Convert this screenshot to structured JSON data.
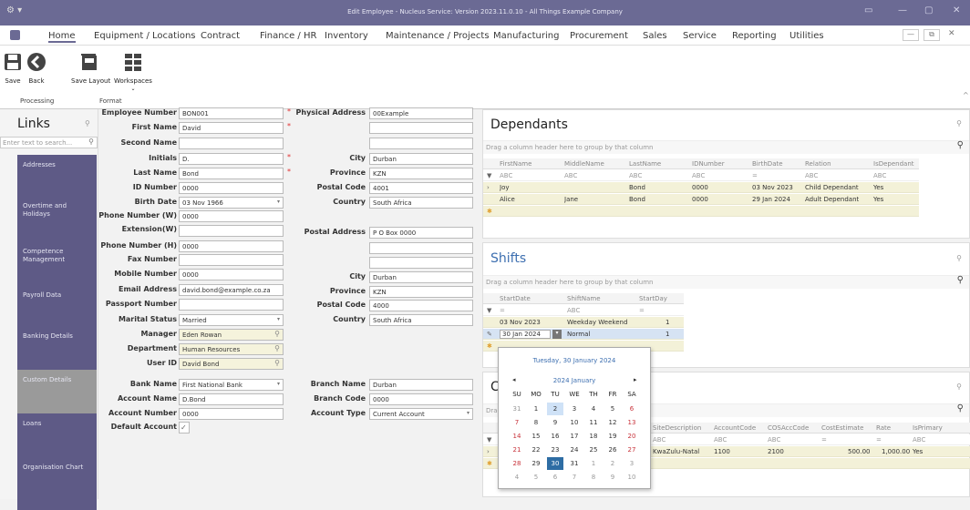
{
  "window": {
    "title": "Edit Employee - Nucleus Service: Version 2023.11.0.10 - All Things Example Company",
    "app_icon": "gear-icon"
  },
  "menu": [
    "Home",
    "Equipment / Locations",
    "Contract",
    "Finance / HR",
    "Inventory",
    "Maintenance / Projects",
    "Manufacturing",
    "Procurement",
    "Sales",
    "Service",
    "Reporting",
    "Utilities"
  ],
  "ribbon": {
    "save": "Save",
    "back": "Back",
    "save_layout": "Save Layout",
    "workspaces": "Workspaces",
    "group_processing": "Processing",
    "group_format": "Format"
  },
  "links": {
    "title": "Links",
    "search_placeholder": "Enter text to search...",
    "items": [
      "Addresses",
      "Overtime and Holidays",
      "Competence Management",
      "Payroll Data",
      "Banking Details",
      "Custom Details",
      "Loans",
      "Organisation Chart"
    ]
  },
  "employee": {
    "labels": {
      "employee_number": "Employee Number",
      "first_name": "First Name",
      "second_name": "Second Name",
      "initials": "Initials",
      "last_name": "Last Name",
      "id_number": "ID Number",
      "birth_date": "Birth Date",
      "phone_w": "Phone Number (W)",
      "extension": "Extension(W)",
      "phone_h": "Phone Number (H)",
      "fax": "Fax Number",
      "mobile": "Mobile Number",
      "email": "Email Address",
      "passport": "Passport Number",
      "marital": "Marital Status",
      "manager": "Manager",
      "department": "Department",
      "user_id": "User ID",
      "bank_name": "Bank Name",
      "account_name": "Account Name",
      "account_number": "Account Number",
      "default_account": "Default Account"
    },
    "values": {
      "employee_number": "BON001",
      "first_name": "David",
      "second_name": "",
      "initials": "D.",
      "last_name": "Bond",
      "id_number": "0000",
      "birth_date": "03 Nov 1966",
      "phone_w": "0000",
      "extension": "",
      "phone_h": "0000",
      "fax": "",
      "mobile": "0000",
      "email": "david.bond@example.co.za",
      "passport": "",
      "marital": "Married",
      "manager": "Eden Rowan",
      "department": "Human Resources",
      "user_id": "David Bond",
      "bank_name": "First National Bank",
      "account_name": "D.Bond",
      "account_number": "0000",
      "default_account": "✓"
    }
  },
  "address": {
    "labels": {
      "physical": "Physical Address",
      "city": "City",
      "province": "Province",
      "postal_code": "Postal Code",
      "country": "Country",
      "postal": "Postal Address",
      "city2": "City",
      "province2": "Province",
      "postal_code2": "Postal Code",
      "country2": "Country",
      "branch_name": "Branch Name",
      "branch_code": "Branch Code",
      "account_type": "Account Type"
    },
    "values": {
      "physical1": "00Example",
      "physical2": "",
      "physical3": "",
      "city": "Durban",
      "province": "KZN",
      "postal_code": "4001",
      "country": "South Africa",
      "postal1": "P O Box 0000",
      "postal2": "",
      "postal3": "",
      "city2": "Durban",
      "province2": "KZN",
      "postal_code2": "4000",
      "country2": "South Africa",
      "branch_name": "Durban",
      "branch_code": "0000",
      "account_type": "Current Account"
    }
  },
  "dependants": {
    "title": "Dependants",
    "drag_hint": "Drag a column header here to group by that column",
    "columns": [
      "FirstName",
      "MiddleName",
      "LastName",
      "IDNumber",
      "BirthDate",
      "Relation",
      "IsDependant"
    ],
    "filters": [
      "ABC",
      "ABC",
      "ABC",
      "ABC",
      "=",
      "ABC",
      "ABC"
    ],
    "rows": [
      [
        "Joy",
        "",
        "Bond",
        "0000",
        "03 Nov 2023",
        "Child Dependant",
        "Yes"
      ],
      [
        "Alice",
        "Jane",
        "Bond",
        "0000",
        "29 Jan 2024",
        "Adult Dependant",
        "Yes"
      ]
    ]
  },
  "shifts": {
    "title": "Shifts",
    "drag_hint": "Drag a column header here to group by that column",
    "columns": [
      "StartDate",
      "ShiftName",
      "StartDay"
    ],
    "filters": [
      "=",
      "ABC",
      "="
    ],
    "rows": [
      [
        "03 Nov 2023",
        "Weekday Weekend",
        "1"
      ],
      [
        "30 Jan 2024",
        "Normal",
        "1"
      ]
    ]
  },
  "costing": {
    "title": "C",
    "drag_hint": "Drag",
    "columns": [
      "SiteDescription",
      "AccountCode",
      "COSAccCode",
      "CostEstimate",
      "Rate",
      "IsPrimary"
    ],
    "filters": [
      "ABC",
      "ABC",
      "ABC",
      "=",
      "=",
      "ABC"
    ],
    "rows": [
      [
        "KwaZulu-Natal",
        "1100",
        "2100",
        "500.00",
        "1,000.00",
        "Yes"
      ]
    ]
  },
  "calendar": {
    "header": "Tuesday, 30 January 2024",
    "month": "2024 January",
    "days": [
      "SU",
      "MO",
      "TU",
      "WE",
      "TH",
      "FR",
      "SA"
    ],
    "weeks": [
      [
        "31",
        "1",
        "2",
        "3",
        "4",
        "5",
        "6"
      ],
      [
        "7",
        "8",
        "9",
        "10",
        "11",
        "12",
        "13"
      ],
      [
        "14",
        "15",
        "16",
        "17",
        "18",
        "19",
        "20"
      ],
      [
        "21",
        "22",
        "23",
        "24",
        "25",
        "26",
        "27"
      ],
      [
        "28",
        "29",
        "30",
        "31",
        "1",
        "2",
        "3"
      ],
      [
        "4",
        "5",
        "6",
        "7",
        "8",
        "9",
        "10"
      ]
    ],
    "today": "2",
    "selected": "30"
  },
  "colors": {
    "title_bar": "#6b6a94",
    "link_tile": "#5e5a86",
    "accent": "#2e6da4"
  }
}
